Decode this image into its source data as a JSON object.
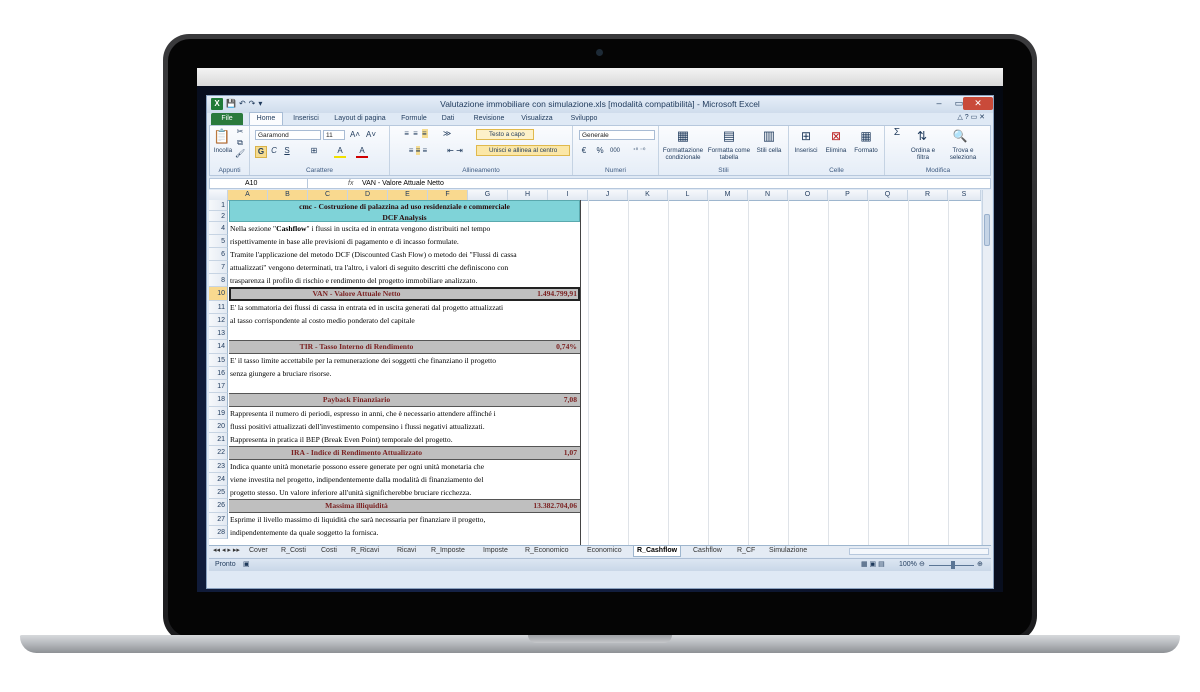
{
  "window": {
    "title": "Valutazione immobiliare con simulazione.xls  [modalità compatibilità]  -  Microsoft Excel",
    "min": "–",
    "max": "▭",
    "close": "✕"
  },
  "quick_access": [
    "X",
    "💾",
    "↶",
    "↷",
    "▾"
  ],
  "ribbon_tabs": [
    "File",
    "Home",
    "Inserisci",
    "Layout di pagina",
    "Formule",
    "Dati",
    "Revisione",
    "Visualizza",
    "Sviluppo"
  ],
  "ribbon": {
    "appunti": {
      "group": "Appunti",
      "paste": "Incolla",
      "paste_icon": "📋",
      "cut": "✂",
      "copy": "⧉",
      "painter": "🖌"
    },
    "carattere": {
      "group": "Carattere",
      "font": "Garamond",
      "size": "11",
      "grow": "A˄",
      "shrink": "A˅",
      "bold": "G",
      "italic": "C",
      "underline": "S",
      "borders": "⊞",
      "fill": "A",
      "color": "A"
    },
    "allineamento": {
      "group": "Allineamento",
      "wrap": "Testo a capo",
      "merge": "Unisci e allinea al centro"
    },
    "numeri": {
      "group": "Numeri",
      "format": "Generale",
      "pct": "%",
      "thousands": "000",
      "currency": "€"
    },
    "stili": {
      "group": "Stili",
      "cond": "Formattazione condizionale",
      "table": "Formatta come tabella",
      "cell": "Stili cella"
    },
    "celle": {
      "group": "Celle",
      "insert": "Inserisci",
      "delete": "Elimina",
      "format": "Formato"
    },
    "modifica": {
      "group": "Modifica",
      "sort": "Ordina e filtra",
      "find": "Trova e seleziona",
      "sum": "Σ"
    }
  },
  "formula_bar": {
    "cell_ref": "A10",
    "fx": "fx",
    "value": "VAN - Valore Attuale Netto"
  },
  "columns": [
    "A",
    "B",
    "C",
    "D",
    "E",
    "F",
    "G",
    "H",
    "I",
    "J",
    "K",
    "L",
    "M",
    "N",
    "O",
    "P",
    "Q",
    "R",
    "S"
  ],
  "rows": [
    "1",
    "2",
    "4",
    "5",
    "6",
    "7",
    "8",
    "10",
    "11",
    "12",
    "13",
    "14",
    "15",
    "16",
    "17",
    "18",
    "19",
    "20",
    "21",
    "22",
    "23",
    "24",
    "25",
    "26",
    "27",
    "28"
  ],
  "sheet": {
    "title1": "cmc - Costruzione di palazzina ad uso residenziale e commerciale",
    "title2": "DCF Analysis",
    "r4_pre": "Nella sezione \"",
    "r4_bold": "Cashflow",
    "r4_post": "\" i flussi in uscita ed in entrata vengono distribuiti nel tempo",
    "r5": "rispettivamente in base alle previsioni di pagamento e di incasso formulate.",
    "r6": "Tramite l'applicazione del metodo DCF (Discounted Cash Flow) o metodo dei \"Flussi di cassa",
    "r7": "attualizzati\" vengono determinati, tra l'altro, i valori di seguito descritti che definiscono con",
    "r8": "trasparenza il profilo di rischio e rendimento del progetto immobiliare analizzato.",
    "van_label": "VAN - Valore Attuale Netto",
    "van_value": "1.494.799,91",
    "r11": "E' la sommatoria dei flussi di cassa in entrata ed in uscita generati dal progetto attualizzati",
    "r12": "al tasso corrispondente al costo medio ponderato del capitale",
    "tir_label": "TIR - Tasso Interno di Rendimento",
    "tir_value": "0,74%",
    "r15": "E' il tasso limite accettabile per la remunerazione dei soggetti che finanziano il progetto",
    "r16": "senza giungere a bruciare risorse.",
    "payback_label": "Payback Finanziario",
    "payback_value": "7,08",
    "r19": "Rappresenta il numero di periodi, espresso in anni, che è necessario attendere affinché i",
    "r20": "flussi positivi attualizzati dell'investimento compensino i flussi negativi attualizzati.",
    "r21": "Rappresenta in pratica il BEP (Break Even Point) temporale del progetto.",
    "ira_label": "IRA - Indice di Rendimento Attualizzato",
    "ira_value": "1,07",
    "r23": "Indica quante unità monetarie possono essere generate per ogni unità monetaria che",
    "r24": "viene investita nel progetto, indipendentemente dalla modalità di finanziamento del",
    "r25": "progetto stesso. Un valore inferiore all'unità significherebbe bruciare ricchezza.",
    "mi_label": "Massima illiquidità",
    "mi_value": "13.382.704,06",
    "r27": "Esprime il livello massimo di liquidità che sarà necessaria per finanziare il progetto,",
    "r28": "indipendentemente da quale soggetto la fornisca."
  },
  "sheet_tabs": [
    "Cover",
    "R_Costi",
    "Costi",
    "R_Ricavi",
    "Ricavi",
    "R_Imposte",
    "Imposte",
    "R_Economico",
    "Economico",
    "R_Cashflow",
    "Cashflow",
    "R_CF",
    "Simulazione"
  ],
  "active_sheet": "R_Cashflow",
  "status": {
    "ready": "Pronto",
    "zoom": "100%"
  }
}
